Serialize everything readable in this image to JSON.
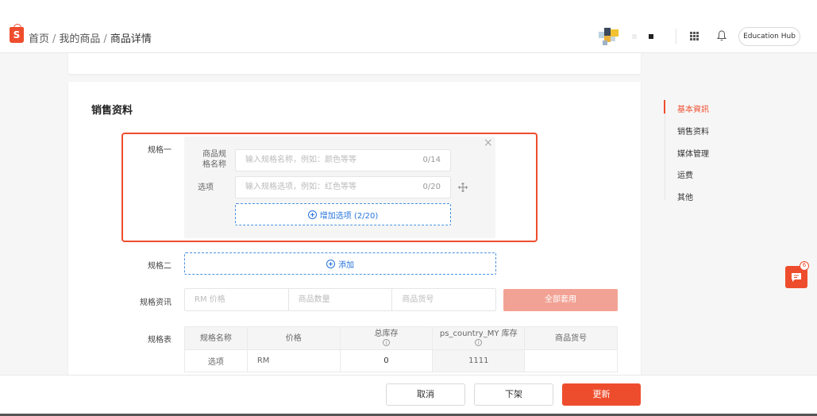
{
  "header": {
    "logo_letter": "S",
    "breadcrumb": [
      "首页",
      "我的商品",
      "商品详情"
    ],
    "edu_hub_label": "Education Hub"
  },
  "sales": {
    "title": "销售资料",
    "spec1": {
      "label": "规格一",
      "name_label_l1": "商品规",
      "name_label_l2": "格名称",
      "name_placeholder": "输入规格名称，例如：颜色等等",
      "name_count": "0/14",
      "option_label": "选项",
      "option_placeholder": "输入规格选项，例如：红色等等",
      "option_count": "0/20",
      "add_option_label": "增加选项 (2/20)"
    },
    "spec2": {
      "label": "规格二",
      "add_label": "添加"
    },
    "spec_info": {
      "label": "规格资讯",
      "price_placeholder": "RM 价格",
      "stock_placeholder": "商品数量",
      "sku_placeholder": "商品货号",
      "apply_all_label": "全部套用"
    },
    "spec_table": {
      "label": "规格表",
      "headers": [
        "规格名称",
        "价格",
        "总库存",
        "ps_country_MY 库存",
        "商品货号"
      ],
      "row": {
        "name": "选项",
        "price": "RM",
        "total_stock": "0",
        "country_stock": "1111",
        "sku": ""
      }
    }
  },
  "right_nav": {
    "items": [
      "基本資訊",
      "销售资料",
      "媒体管理",
      "运费",
      "其他"
    ],
    "active_index": 0
  },
  "chat": {
    "badge": "6"
  },
  "footer": {
    "cancel_label": "取消",
    "unlist_label": "下架",
    "update_label": "更新"
  },
  "colors": {
    "brand": "#ee4d2d",
    "link_blue": "#2673dd",
    "apply_disabled": "#f2a294"
  }
}
